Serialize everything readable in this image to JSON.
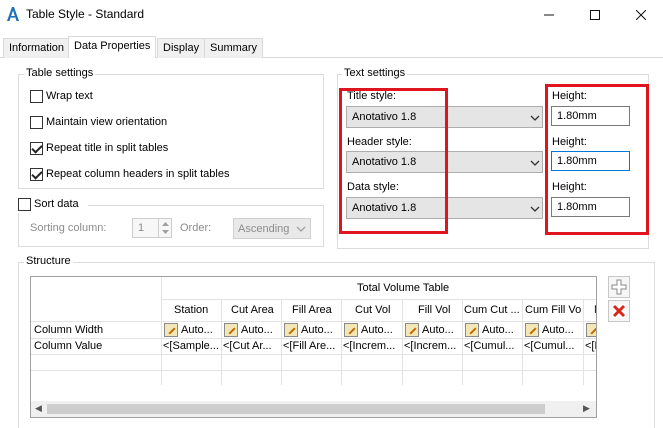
{
  "window": {
    "title": "Table Style - Standard",
    "minimize": "—",
    "maximize": "☐",
    "close": "✕"
  },
  "tabs": [
    {
      "label": "Information",
      "active": false
    },
    {
      "label": "Data Properties",
      "active": true
    },
    {
      "label": "Display",
      "active": false
    },
    {
      "label": "Summary",
      "active": false
    }
  ],
  "table_settings": {
    "group_label": "Table settings",
    "wrap_text": {
      "label": "Wrap text",
      "checked": false
    },
    "maintain_view": {
      "label": "Maintain view orientation",
      "checked": false
    },
    "repeat_title": {
      "label": "Repeat title in split tables",
      "checked": true
    },
    "repeat_headers": {
      "label": "Repeat column headers in split tables",
      "checked": true
    }
  },
  "sort_data": {
    "label": "Sort data",
    "checked": false,
    "sorting_column_label": "Sorting column:",
    "sorting_column_value": "1",
    "order_label": "Order:",
    "order_value": "Ascending"
  },
  "text_settings": {
    "group_label": "Text settings",
    "title_style_label": "Title style:",
    "title_style_value": "Anotativo 1.8",
    "header_style_label": "Header style:",
    "header_style_value": "Anotativo 1.8",
    "data_style_label": "Data style:",
    "data_style_value": "Anotativo 1.8",
    "height_label": "Height:",
    "title_height": "1.80mm",
    "header_height": "1.80mm",
    "data_height": "1.80mm"
  },
  "structure": {
    "group_label": "Structure",
    "table_title": "Total Volume Table",
    "row_labels": [
      "Column Width",
      "Column Value"
    ],
    "columns": [
      {
        "header": "Station",
        "width": "Auto...",
        "value": "<[Sample..."
      },
      {
        "header": "Cut Area",
        "width": "Auto...",
        "value": "<[Cut Ar..."
      },
      {
        "header": "Fill Area",
        "width": "Auto...",
        "value": "<[Fill Are..."
      },
      {
        "header": "Cut Vol",
        "width": "Auto...",
        "value": "<[Increm..."
      },
      {
        "header": "Fill Vol",
        "width": "Auto...",
        "value": "<[Increm..."
      },
      {
        "header": "Cum Cut ...",
        "width": "Auto...",
        "value": "<[Cumul..."
      },
      {
        "header": "Cum Fill Vol",
        "width": "Auto...",
        "value": "<[Cumul..."
      },
      {
        "header": "N",
        "width": "",
        "value": "<[N"
      }
    ],
    "scroll_left": "◀",
    "scroll_right": "▶"
  },
  "colors": {
    "highlight": "#e0141e",
    "focus": "#0078d7",
    "scroll_thumb": "#cdcdcd"
  }
}
